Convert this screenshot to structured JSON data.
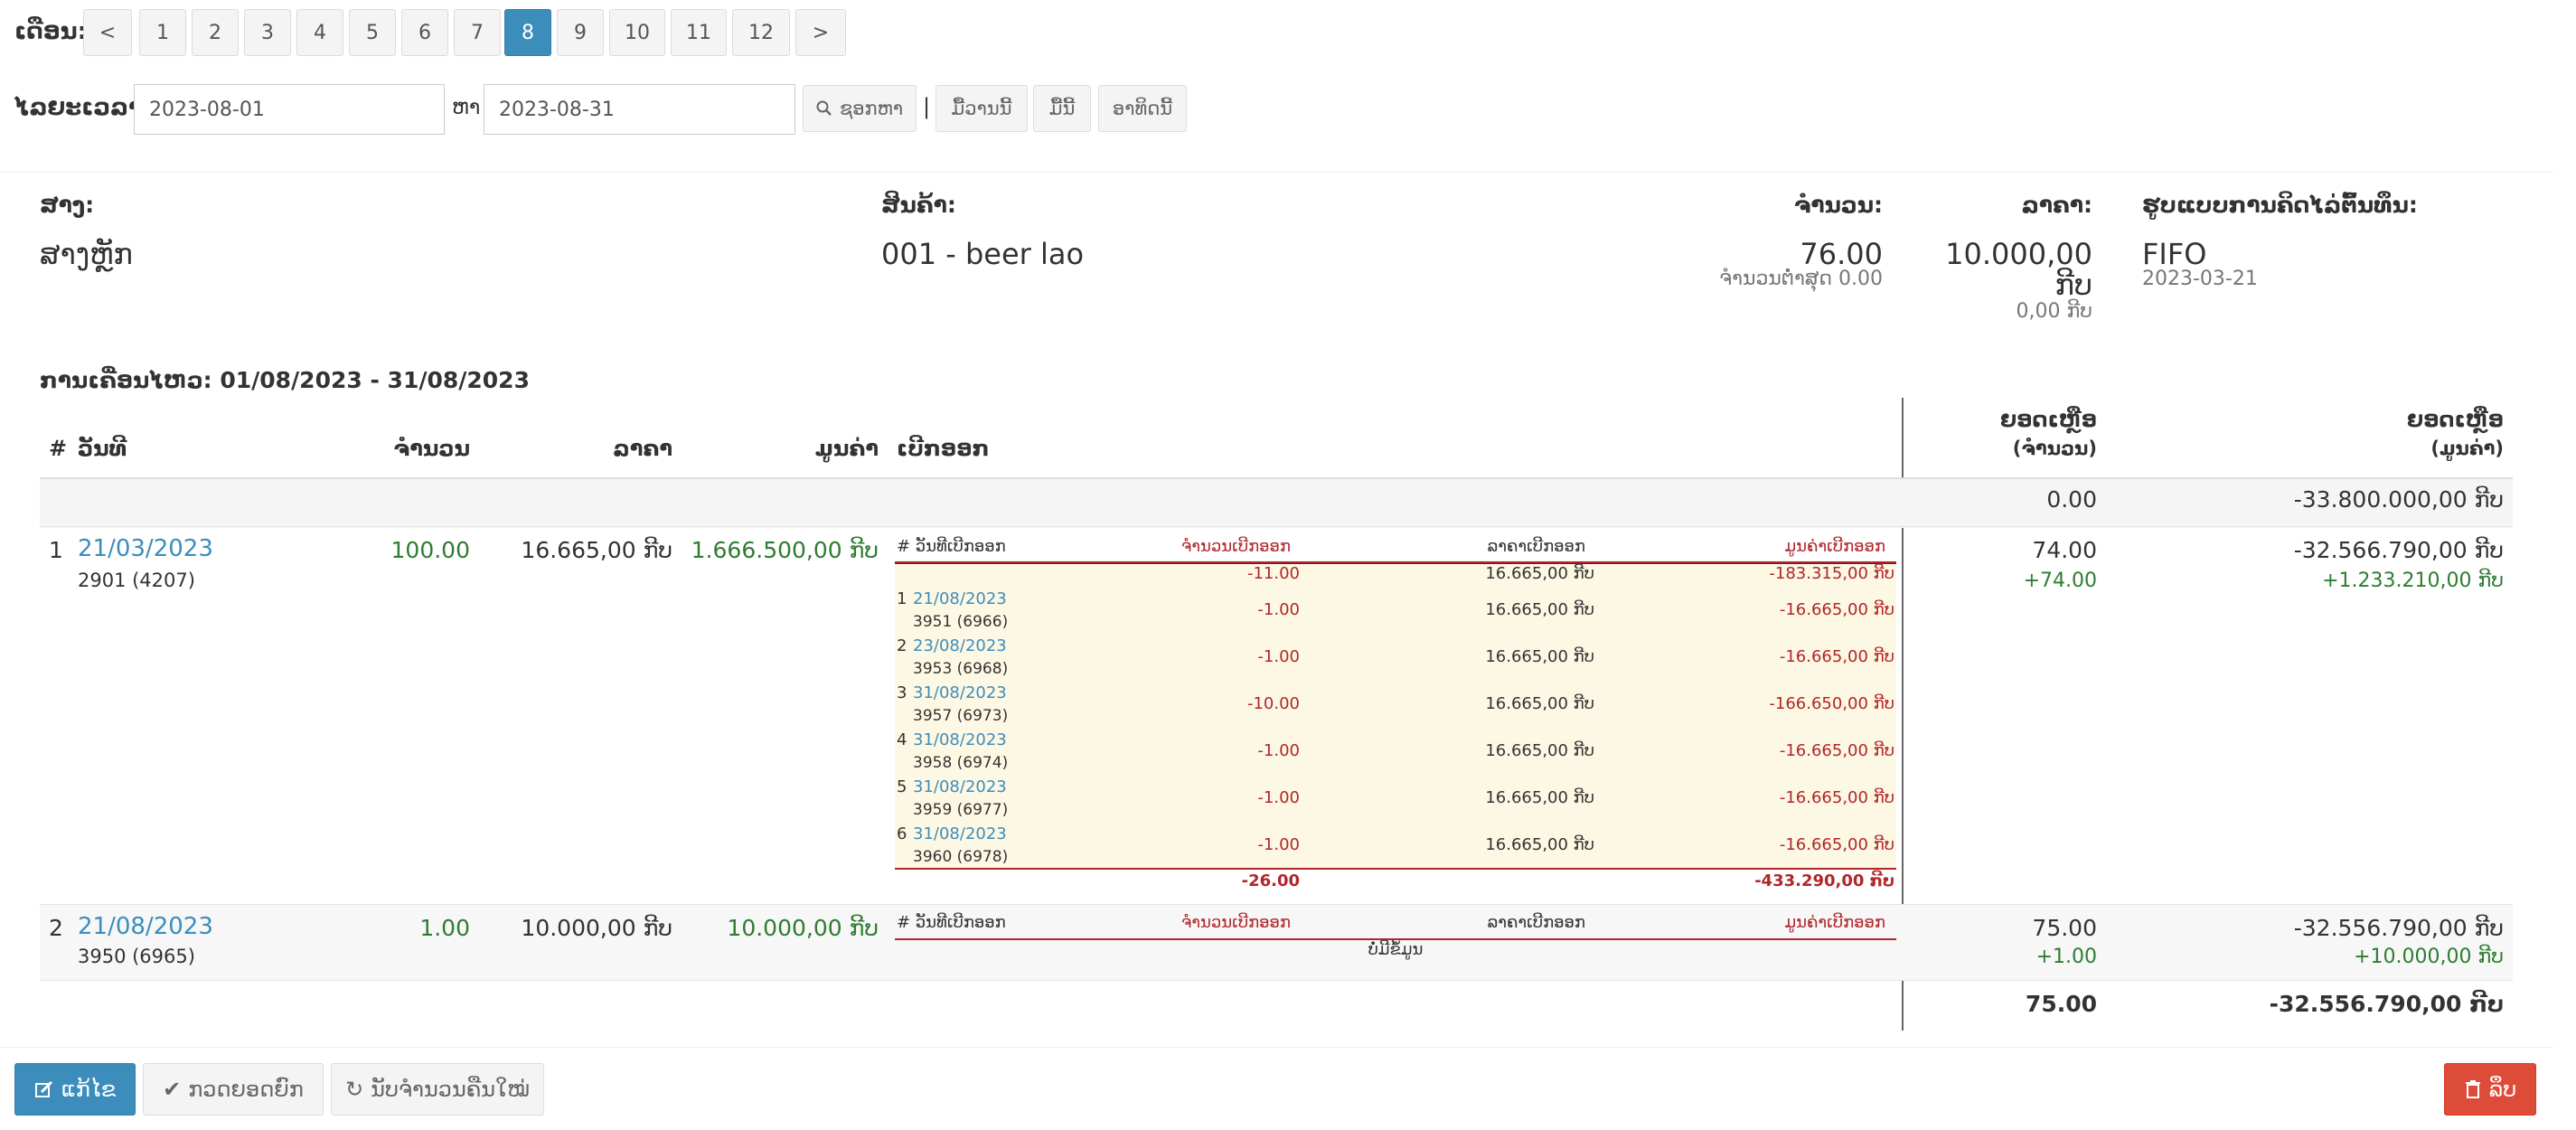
{
  "filter": {
    "month_label": "ເດືອນ:",
    "pages": [
      "<",
      "1",
      "2",
      "3",
      "4",
      "5",
      "6",
      "7",
      "8",
      "9",
      "10",
      "11",
      "12",
      ">"
    ],
    "active_page": "8",
    "period_label": "ໄລຍະເວລາ:",
    "date_from": "2023-08-01",
    "to_label": "ຫາ",
    "date_to": "2023-08-31",
    "search_label": "ຊອກຫາ",
    "separator": "|",
    "today_label": "ມື້ວານນີ້",
    "day_label": "ມື້ນີ້",
    "week_label": "ອາທິດນີ້"
  },
  "summary": {
    "branch_label": "ສາງ:",
    "branch_value": "ສາງຫຼັກ",
    "product_label": "ສິນຄ້າ:",
    "product_value": "001 - beer lao",
    "qty_label": "ຈຳນວນ:",
    "qty_value": "76.00",
    "qty_min": "ຈຳນວນຕ່ຳສຸດ 0.00",
    "price_label": "ລາຄາ:",
    "price_value": "10.000,00",
    "price_currency": "ກີບ",
    "price_sub": "0,00 ກີບ",
    "method_label": "ຮູບແບບການຄິດໄລ່ຕົ້ນທຶນ:",
    "method_value": "FIFO",
    "method_date": "2023-03-21"
  },
  "movement_title": "ການເຄື່ອນໄຫວ: 01/08/2023 - 31/08/2023",
  "table_header": {
    "no": "#",
    "date": "ວັນທີ",
    "qty": "ຈຳນວນ",
    "price": "ລາຄາ",
    "value": "ມູນຄ່າ",
    "issue": "ເບີກອອກ",
    "bal_qty_1": "ຍອດເຫຼືອ",
    "bal_qty_2": "(ຈຳນວນ)",
    "bal_val_1": "ຍອດເຫຼືອ",
    "bal_val_2": "(ມູນຄ່າ)"
  },
  "opening": {
    "qty": "0.00",
    "value": "-33.800.000,00 ກີບ"
  },
  "inner_header": {
    "no_date": "# ວັນທີເບີກອອກ",
    "qty": "ຈຳນວນເບີກອອກ",
    "price": "ລາຄາເບີກອອກ",
    "value": "ມູນຄ່າເບີກອອກ"
  },
  "rows": [
    {
      "no": "1",
      "date": "21/03/2023",
      "ref": "2901 (4207)",
      "qty": "100.00",
      "price": "16.665,00 ກີບ",
      "value": "1.666.500,00 ກີບ",
      "issue_pre": {
        "qty": "-11.00",
        "price": "16.665,00 ກີບ",
        "value": "-183.315,00 ກີບ"
      },
      "issues": [
        {
          "no": "1",
          "date": "21/08/2023",
          "ref": "3951 (6966)",
          "qty": "-1.00",
          "price": "16.665,00 ກີບ",
          "value": "-16.665,00 ກີບ"
        },
        {
          "no": "2",
          "date": "23/08/2023",
          "ref": "3953 (6968)",
          "qty": "-1.00",
          "price": "16.665,00 ກີບ",
          "value": "-16.665,00 ກີບ"
        },
        {
          "no": "3",
          "date": "31/08/2023",
          "ref": "3957 (6973)",
          "qty": "-10.00",
          "price": "16.665,00 ກີບ",
          "value": "-166.650,00 ກີບ"
        },
        {
          "no": "4",
          "date": "31/08/2023",
          "ref": "3958 (6974)",
          "qty": "-1.00",
          "price": "16.665,00 ກີບ",
          "value": "-16.665,00 ກີບ"
        },
        {
          "no": "5",
          "date": "31/08/2023",
          "ref": "3959 (6977)",
          "qty": "-1.00",
          "price": "16.665,00 ກີບ",
          "value": "-16.665,00 ກີບ"
        },
        {
          "no": "6",
          "date": "31/08/2023",
          "ref": "3960 (6978)",
          "qty": "-1.00",
          "price": "16.665,00 ກີບ",
          "value": "-16.665,00 ກີບ"
        }
      ],
      "issue_total": {
        "qty": "-26.00",
        "value": "-433.290,00 ກີບ"
      },
      "bal_qty": "74.00",
      "bal_qty_delta": "+74.00",
      "bal_val": "-32.566.790,00 ກີບ",
      "bal_val_delta": "+1.233.210,00 ກີບ"
    },
    {
      "no": "2",
      "date": "21/08/2023",
      "ref": "3950 (6965)",
      "qty": "1.00",
      "price": "10.000,00 ກີບ",
      "value": "10.000,00 ກີບ",
      "no_data": "ບໍ່ມີຂໍ້ມູນ",
      "bal_qty": "75.00",
      "bal_qty_delta": "+1.00",
      "bal_val": "-32.556.790,00 ກີບ",
      "bal_val_delta": "+10.000,00 ກີບ"
    }
  ],
  "closing": {
    "qty": "75.00",
    "value": "-32.556.790,00 ກີບ"
  },
  "buttons": {
    "edit": "ແກ້ໄຂ",
    "check": "ກວດຍອດຍົກ",
    "recalc": "ນັບຈຳນວນຄືນໃໝ່",
    "delete": "ລຶບ"
  },
  "colors": {
    "primary": "#3c8dbc",
    "danger": "#dd4b39",
    "green": "#2e7d32",
    "red": "#b0262a",
    "inner_bg": "#fdf8e4"
  }
}
